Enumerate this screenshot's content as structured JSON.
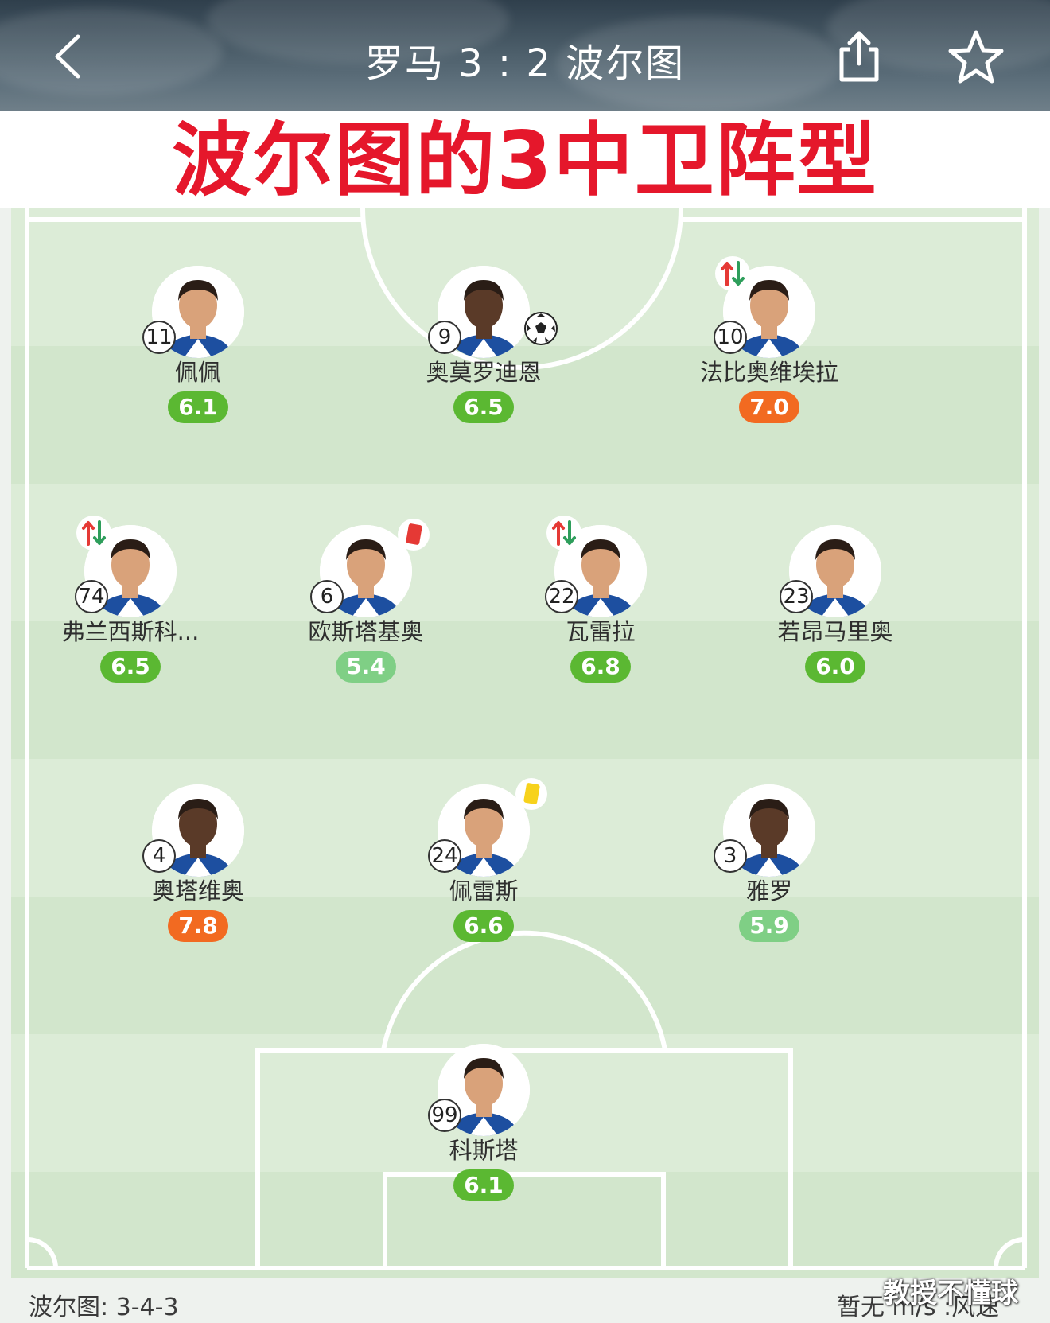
{
  "header": {
    "title": "罗马 3 : 2 波尔图"
  },
  "banner": {
    "text": "波尔图的3中卫阵型"
  },
  "lineup": {
    "forwards": [
      {
        "number": "11",
        "name": "佩佩",
        "rating": "6.1",
        "rating_color": "#5bb832",
        "sub": false,
        "goal": false,
        "card": ""
      },
      {
        "number": "9",
        "name": "奥莫罗迪恩",
        "rating": "6.5",
        "rating_color": "#5bb832",
        "sub": false,
        "goal": true,
        "card": ""
      },
      {
        "number": "10",
        "name": "法比奥维埃拉",
        "rating": "7.0",
        "rating_color": "#f26a21",
        "sub": true,
        "goal": false,
        "card": ""
      }
    ],
    "midfielders": [
      {
        "number": "74",
        "name": "弗兰西斯科...",
        "rating": "6.5",
        "rating_color": "#5bb832",
        "sub": true,
        "goal": false,
        "card": ""
      },
      {
        "number": "6",
        "name": "欧斯塔基奥",
        "rating": "5.4",
        "rating_color": "#7fcf85",
        "sub": false,
        "goal": false,
        "card": "red"
      },
      {
        "number": "22",
        "name": "瓦雷拉",
        "rating": "6.8",
        "rating_color": "#5bb832",
        "sub": true,
        "goal": false,
        "card": ""
      },
      {
        "number": "23",
        "name": "若昂马里奥",
        "rating": "6.0",
        "rating_color": "#5bb832",
        "sub": false,
        "goal": false,
        "card": ""
      }
    ],
    "defenders": [
      {
        "number": "4",
        "name": "奥塔维奥",
        "rating": "7.8",
        "rating_color": "#f26a21",
        "sub": false,
        "goal": false,
        "card": ""
      },
      {
        "number": "24",
        "name": "佩雷斯",
        "rating": "6.6",
        "rating_color": "#5bb832",
        "sub": false,
        "goal": false,
        "card": "yellow"
      },
      {
        "number": "3",
        "name": "雅罗",
        "rating": "5.9",
        "rating_color": "#7fcf85",
        "sub": false,
        "goal": false,
        "card": ""
      }
    ],
    "goalkeeper": [
      {
        "number": "99",
        "name": "科斯塔",
        "rating": "6.1",
        "rating_color": "#5bb832",
        "sub": false,
        "goal": false,
        "card": ""
      }
    ]
  },
  "footer": {
    "formation": "波尔图: 3-4-3",
    "weather": "暂无 m/s :风速",
    "watermark": "教授不懂球"
  },
  "colors": {
    "banner_red": "#e5172b",
    "rating_green": "#5bb832",
    "rating_light_green": "#7fcf85",
    "rating_orange": "#f26a21",
    "pitch_light": "#dcecd7",
    "pitch_dark": "#d2e6cc"
  },
  "icons": {
    "back": "chevron-left-icon",
    "share": "share-icon",
    "favorite": "star-outline-icon",
    "goal": "football-icon",
    "substitution": "substitution-arrows-icon",
    "red_card": "red-card-icon",
    "yellow_card": "yellow-card-icon"
  }
}
